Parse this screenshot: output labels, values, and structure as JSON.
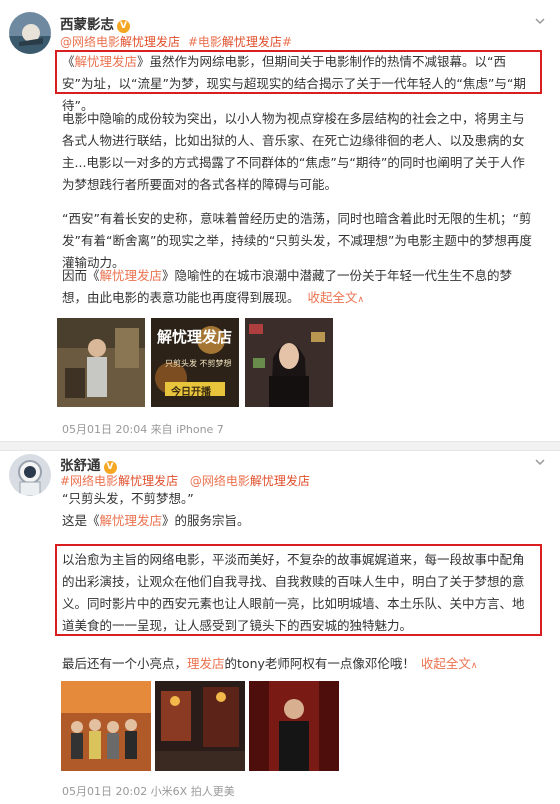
{
  "post1": {
    "author": "西蒙影志",
    "verified_badge": "V",
    "tags": [
      {
        "pre": "@网络电影",
        "hl": "解忧理发店"
      },
      {
        "pre": "#电影",
        "hl": "解忧理发店",
        "post": "#"
      }
    ],
    "para1_parts": [
      "《",
      "解忧理发店",
      "》虽然作为网综电影，但期间关于电影制作的热情不减银幕。以“西安”为址，以“流星”为梦，现实与超现实的结合揭示了关于一代年轻人的“焦虑”与“期待”。"
    ],
    "para2": "电影中隐喻的成份较为突出，以小人物为视点穿梭在多层结构的社会之中，将男主与各式人物进行联结，比如出狱的人、音乐家、在死亡边缘徘徊的老人、以及患病的女主...电影以一对多的方式揭露了不同群体的“焦虑”与“期待”的同时也阐明了关于人作为梦想践行者所要面对的各式各样的障碍与可能。",
    "para3": "“西安”有着长安的史称，意味着曾经历史的浩荡，同时也暗含着此时无限的生机；“剪发”有着“断舍离”的现实之举，持续的“只剪头发，不减理想”为电影主题中的梦想再度灌输动力。",
    "para4_parts": [
      "因而《",
      "解忧理发店",
      "》隐喻性的在城市浪潮中潜藏了一份关于年轻一代生生不息的梦想，由此电影的表意功能也再度得到展现。",
      "收起全文"
    ],
    "images": [
      {
        "kind": "still-barbershop"
      },
      {
        "kind": "poster",
        "title": "解忧理发店",
        "subtitle": "只剪头发 不剪梦想",
        "banner": "今日开播"
      },
      {
        "kind": "portrait"
      }
    ],
    "meta": "05月01日 20:04  来自 iPhone 7"
  },
  "post2": {
    "author": "张舒通",
    "verified_badge": "V",
    "tags": [
      {
        "pre": "#网络电影",
        "hl": "解忧理发店"
      },
      {
        "pre": "@网络电影",
        "hl": "解忧理发店"
      }
    ],
    "quote": "“只剪头发，不剪梦想。”",
    "service_parts": [
      "这是《",
      "解忧理发店",
      "》的服务宗旨。"
    ],
    "boxed": "以治愈为主旨的网络电影，平淡而美好，不复杂的故事娓娓道来，每一段故事中配角的出彩演技，让观众在他们自我寻找、自我救赎的百味人生中，明白了关于梦想的意义。同时影片中的西安元素也让人眼前一亮，比如明城墙、本土乐队、关中方言、地道美食的一一呈现，让人感受到了镜头下的西安城的独特魅力。",
    "last_parts": [
      "最后还有一个小亮点，",
      "理发店",
      "的tony老师阿权有一点像邓伦哦！",
      "收起全文"
    ],
    "images": [
      {
        "kind": "group"
      },
      {
        "kind": "street-night"
      },
      {
        "kind": "man-red"
      }
    ],
    "meta": "05月01日 20:02  小米6X 拍人更美"
  },
  "colors": {
    "accent": "#eb7350",
    "box": "#d81e1e",
    "badge": "#f5a623"
  },
  "icons": [
    "chevron-down-icon",
    "verified-icon"
  ]
}
